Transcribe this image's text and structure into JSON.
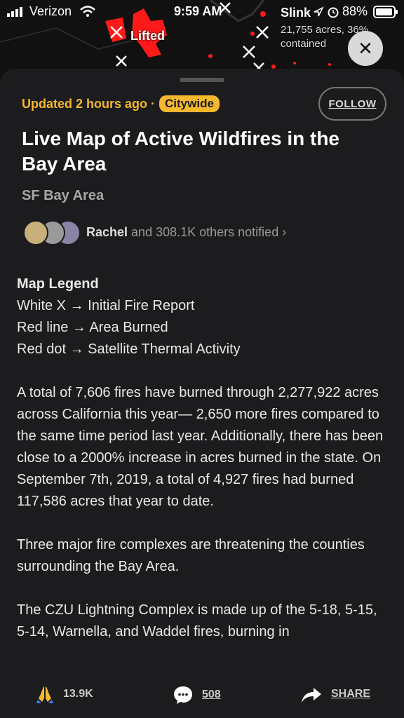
{
  "status_bar": {
    "carrier": "Verizon",
    "time": "9:59 AM",
    "battery_percent": "88%"
  },
  "map": {
    "label_lifted": "Lifted",
    "label_slink": "Slink",
    "slink_sub_line1": "21,755 acres, 36%",
    "slink_sub_line2": "contained"
  },
  "header": {
    "updated": "Updated 2 hours ago ·",
    "badge": "Citywide",
    "follow_label": "FOLLOW",
    "close_icon": "✕"
  },
  "article": {
    "title": "Live Map of Active Wildfires in the Bay Area",
    "location": "SF Bay Area",
    "notified_name": "Rachel",
    "notified_rest": "and 308.1K others notified ›",
    "legend_title": "Map Legend",
    "legend_items": [
      "White X → Initial Fire Report",
      "Red line → Area Burned",
      "Red dot → Satellite Thermal Activity"
    ],
    "paragraphs": [
      "A total of 7,606 fires have burned through 2,277,922 acres across California this year— 2,650 more fires compared to the same time period last year. Additionally, there has been close to a 2000% increase in acres burned in the state. On September 7th, 2019, a total of 4,927 fires had burned 117,586 acres that year to date.",
      "Three major fire complexes are threatening the counties surrounding the Bay Area.",
      "The CZU Lightning Complex is made up of the 5-18, 5-15, 5-14, Warnella, and Waddel fires, burning in"
    ]
  },
  "bottom_bar": {
    "pray_count": "13.9K",
    "comment_count": "508",
    "share_label": "SHARE"
  },
  "colors": {
    "accent": "#f5b82e",
    "sheet_bg": "#1c1c1e",
    "fire_red": "#ff1a1a"
  }
}
